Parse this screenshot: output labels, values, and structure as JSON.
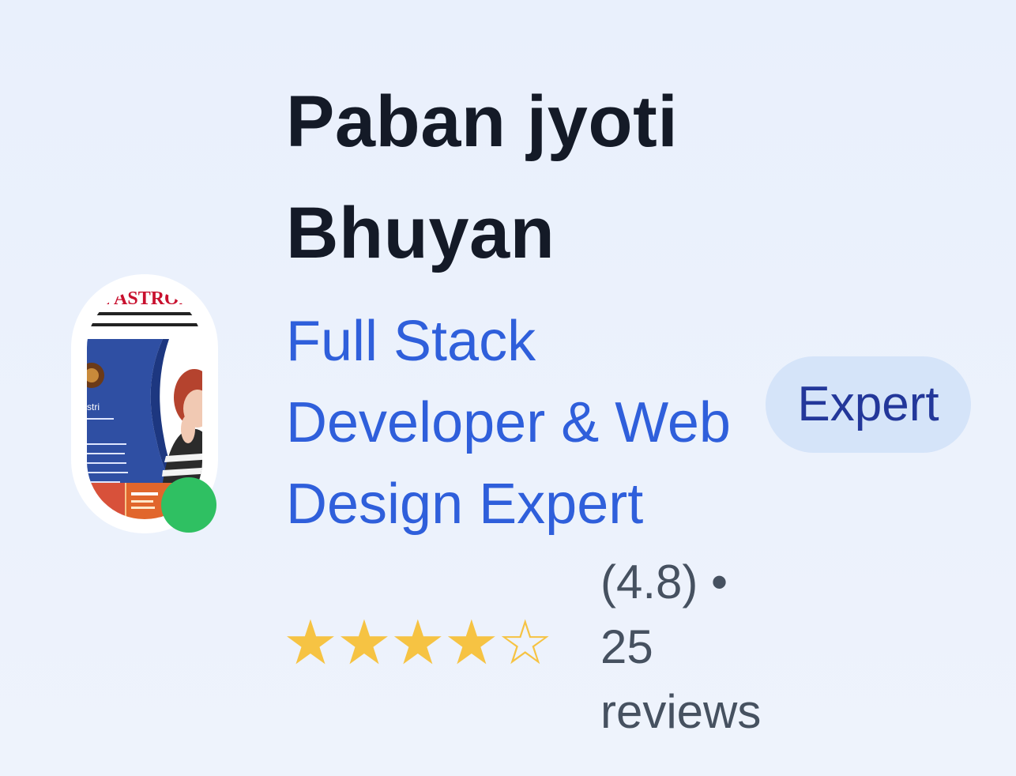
{
  "profile": {
    "name": "Paban jyoti Bhuyan",
    "title": "Full Stack Developer & Web Design Expert",
    "badge": "Expert",
    "online": true
  },
  "avatar": {
    "banner_text": "NE ASTROL",
    "side_text": "stri"
  },
  "rating": {
    "value": 4.8,
    "stars_filled": 4,
    "stars_total": 5,
    "star_filled_glyph": "★",
    "star_empty_glyph": "☆",
    "summary": "(4.8) • 25 reviews"
  },
  "colors": {
    "name": "#141a27",
    "title": "#2f5fdb",
    "badge_bg": "#d5e4f9",
    "badge_text": "#23379a",
    "star": "#f6c343",
    "online": "#2fc062",
    "muted": "#465160"
  }
}
